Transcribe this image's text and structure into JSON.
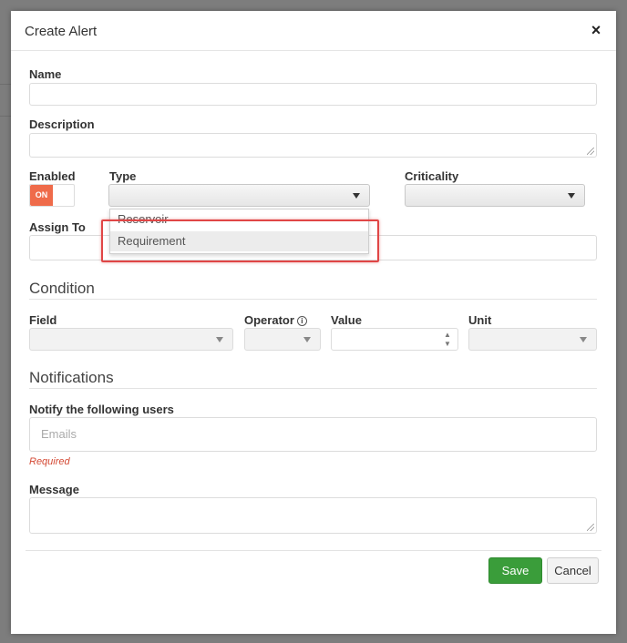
{
  "modal": {
    "title": "Create Alert",
    "close_glyph": "×"
  },
  "form": {
    "name_label": "Name",
    "description_label": "Description",
    "enabled_label": "Enabled",
    "enabled_toggle": "ON",
    "type_label": "Type",
    "type_value": "",
    "type_options": [
      "Reservoir",
      "Requirement"
    ],
    "criticality_label": "Criticality",
    "assign_to_label": "Assign To"
  },
  "condition": {
    "title": "Condition",
    "field_label": "Field",
    "operator_label": "Operator",
    "operator_info_glyph": "i",
    "value_label": "Value",
    "unit_label": "Unit",
    "spinner_up": "▲",
    "spinner_down": "▼"
  },
  "notifications": {
    "title": "Notifications",
    "notify_label": "Notify the following users",
    "emails_placeholder": "Emails",
    "required_text": "Required",
    "message_label": "Message"
  },
  "footer": {
    "save_label": "Save",
    "cancel_label": "Cancel"
  },
  "colors": {
    "toggle_on": "#ef6b4a",
    "save_button": "#3a9d3a",
    "highlight": "#e04646",
    "required": "#d44a35"
  }
}
